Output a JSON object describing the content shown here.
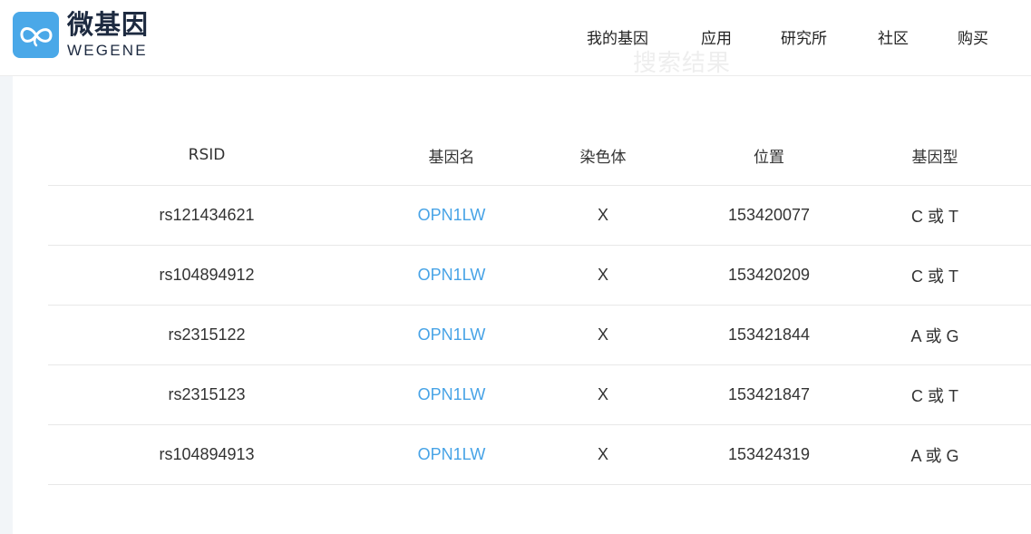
{
  "header": {
    "logo_cn": "微基因",
    "logo_en": "WEGENE",
    "nav": [
      "我的基因",
      "应用",
      "研究所",
      "社区",
      "购买"
    ]
  },
  "ghost_title": "搜索结果",
  "table": {
    "columns": [
      "RSID",
      "基因名",
      "染色体",
      "位置",
      "基因型"
    ],
    "rows": [
      [
        "rs121434621",
        "OPN1LW",
        "X",
        "153420077",
        "C 或 T"
      ],
      [
        "rs104894912",
        "OPN1LW",
        "X",
        "153420209",
        "C 或 T"
      ],
      [
        "rs2315122",
        "OPN1LW",
        "X",
        "153421844",
        "A 或 G"
      ],
      [
        "rs2315123",
        "OPN1LW",
        "X",
        "153421847",
        "C 或 T"
      ],
      [
        "rs104894913",
        "OPN1LW",
        "X",
        "153424319",
        "A 或 G"
      ]
    ]
  },
  "colors": {
    "accent": "#47a3e6",
    "logo_bg": "#4aa8e8",
    "logo_text": "#1d2a40"
  }
}
